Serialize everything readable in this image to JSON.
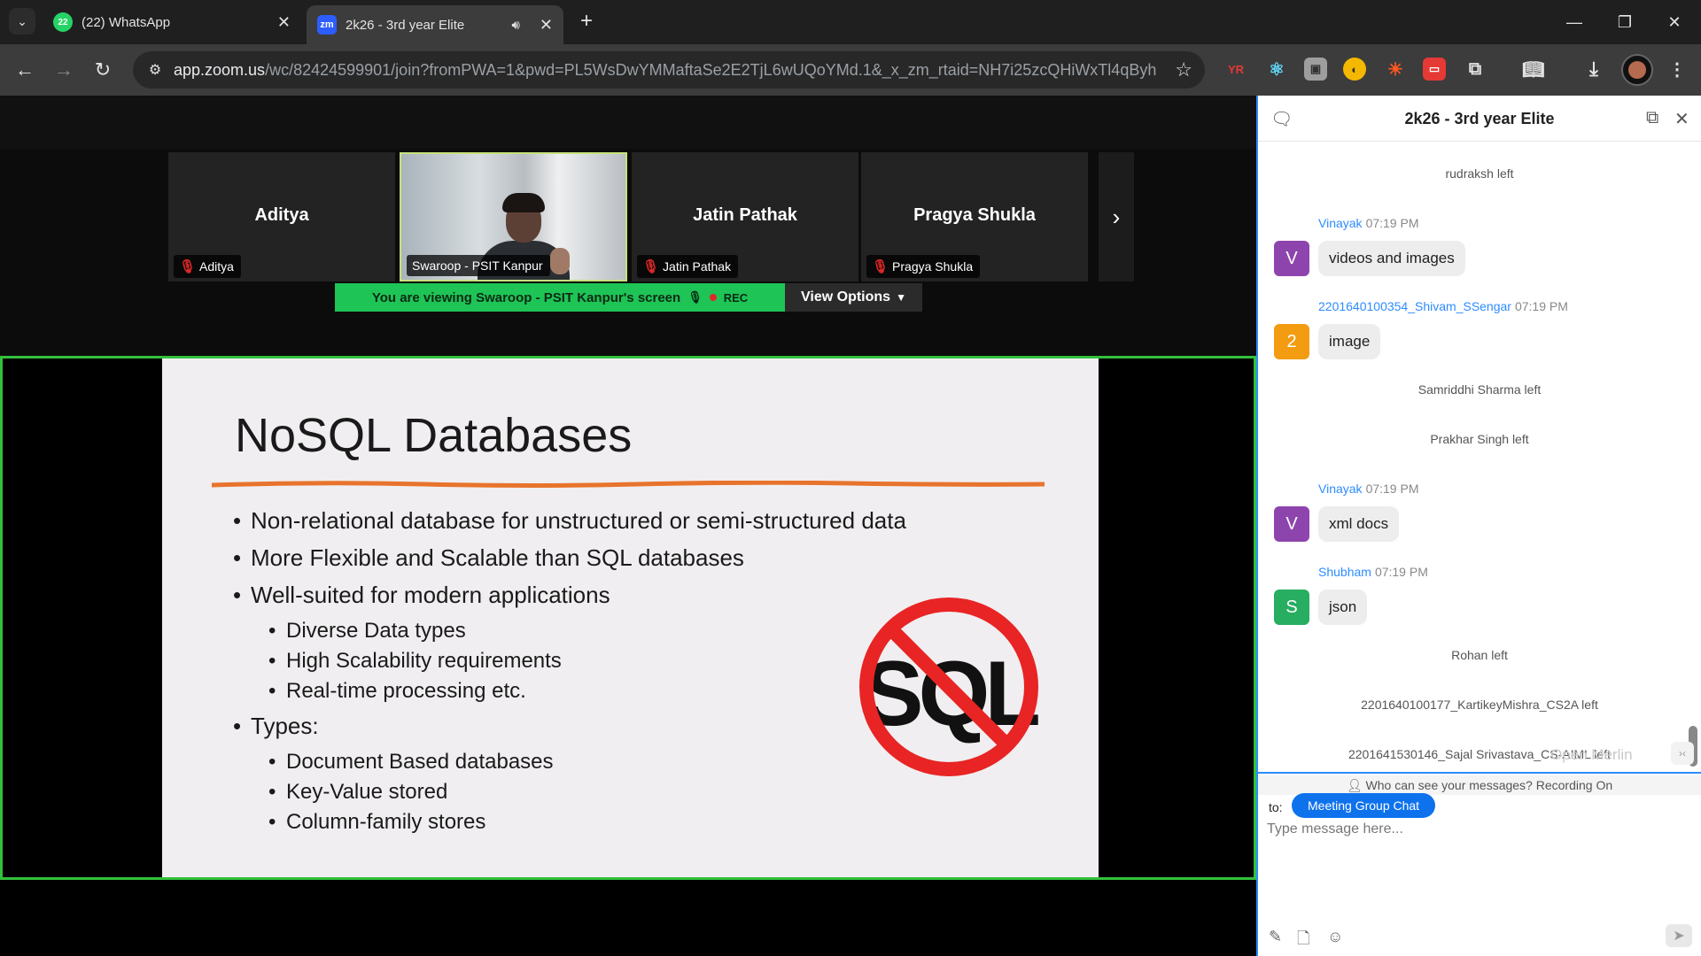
{
  "browser": {
    "tabs": [
      {
        "title": "(22) WhatsApp",
        "badge": "22",
        "close": "✕"
      },
      {
        "title": "2k26 - 3rd year Elite",
        "favicon": "zm",
        "close": "✕"
      }
    ],
    "url_host": "app.zoom.us",
    "url_rest": "/wc/82424599901/join?fromPWA=1&pwd=PL5WsDwYMMaftaSe2E2TjL6wUQoYMd.1&_x_zm_rtaid=NH7i25zcQHiWxTl4qByhSQ.1...",
    "extension_yr": "YR"
  },
  "meeting": {
    "participants": [
      {
        "tile_name": "Aditya",
        "label": "Aditya",
        "muted": true
      },
      {
        "tile_name": "",
        "label": "Swaroop - PSIT Kanpur",
        "muted": false,
        "video": true
      },
      {
        "tile_name": "Jatin Pathak",
        "label": "Jatin Pathak",
        "muted": true
      },
      {
        "tile_name": "Pragya Shukla",
        "label": "Pragya Shukla",
        "muted": true
      }
    ],
    "viewing_text": "You are viewing  Swaroop - PSIT Kanpur's screen",
    "rec_label": "REC",
    "view_options": "View Options"
  },
  "slide": {
    "title": "NoSQL Databases",
    "items": [
      {
        "text": "Non-relational database for unstructured or semi-structured data",
        "level": 1
      },
      {
        "text": "More Flexible and Scalable than SQL databases",
        "level": 1
      },
      {
        "text": "Well-suited for modern applications",
        "level": 1
      },
      {
        "text": "Diverse Data types",
        "level": 2
      },
      {
        "text": "High Scalability requirements",
        "level": 2
      },
      {
        "text": "Real-time processing etc.",
        "level": 2
      },
      {
        "text": "Types:",
        "level": 1
      },
      {
        "text": "Document Based databases",
        "level": 2
      },
      {
        "text": "Key-Value stored",
        "level": 2
      },
      {
        "text": "Column-family stores",
        "level": 2
      }
    ],
    "logo_text": "SQL"
  },
  "chat": {
    "title": "2k26 - 3rd year Elite",
    "system_messages": [
      "rudraksh left",
      "Samriddhi Sharma left",
      "Prakhar Singh left",
      "Rohan left",
      "2201640100177_KartikeyMishra_CS2A left",
      "2201641530146_Sajal Srivastava_CS-AIML left"
    ],
    "messages": [
      {
        "sender": "Vinayak",
        "time": "07:19 PM",
        "initial": "V",
        "color": "#8e44ad",
        "text": "videos and images"
      },
      {
        "sender": "2201640100354_Shivam_SSengar",
        "time": "07:19 PM",
        "initial": "2",
        "color": "#f39c12",
        "text": "image"
      },
      {
        "sender": "Vinayak",
        "time": "07:19 PM",
        "initial": "V",
        "color": "#8e44ad",
        "text": "xml docs"
      },
      {
        "sender": "Shubham",
        "time": "07:19 PM",
        "initial": "S",
        "color": "#27ae60",
        "text": "json"
      }
    ],
    "merlin": "Open Merlin",
    "visibility_note": "Who can see your messages? Recording On",
    "to_label": "to:",
    "recipient": "Meeting Group Chat",
    "placeholder": "Type message here..."
  }
}
